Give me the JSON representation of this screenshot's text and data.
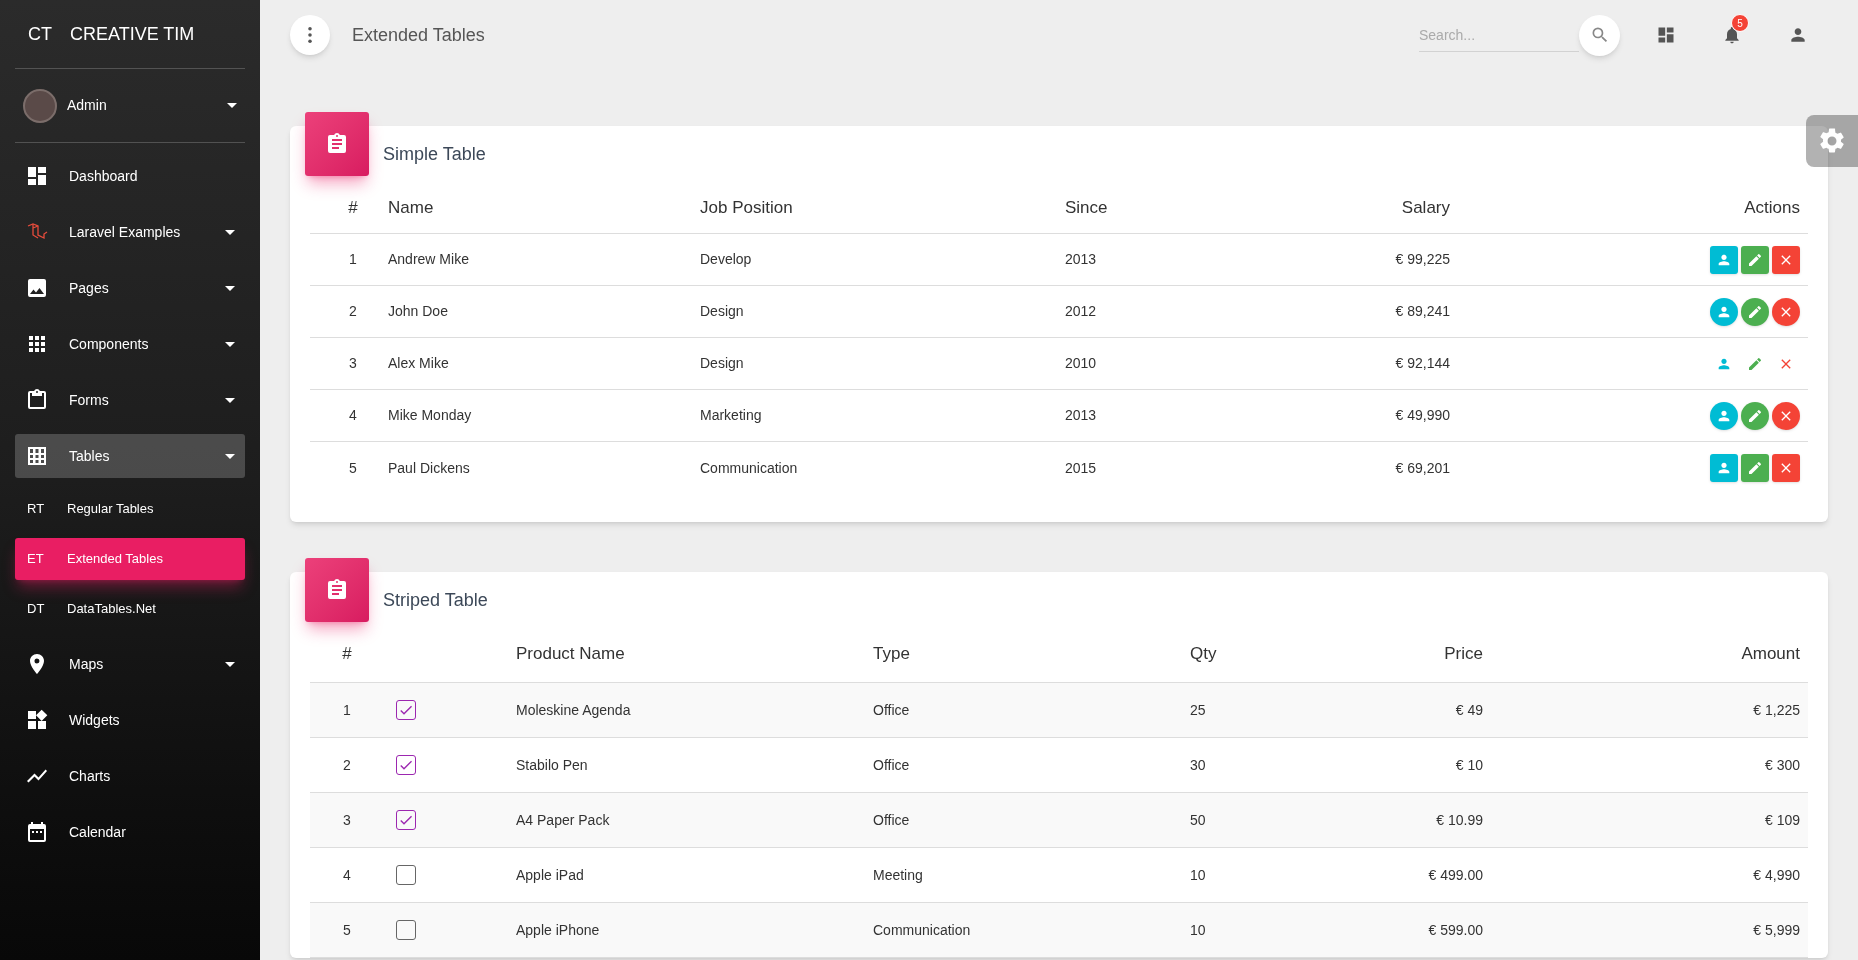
{
  "sidebar": {
    "logo": {
      "abbr": "CT",
      "text": "CREATIVE TIM"
    },
    "user": {
      "name": "Admin",
      "expandable": true
    },
    "items": [
      {
        "label": "Dashboard",
        "expandable": false,
        "selected": false
      },
      {
        "label": "Laravel Examples",
        "expandable": true,
        "selected": false
      },
      {
        "label": "Pages",
        "expandable": true,
        "selected": false
      },
      {
        "label": "Components",
        "expandable": true,
        "selected": false
      },
      {
        "label": "Forms",
        "expandable": true,
        "selected": false
      },
      {
        "label": "Tables",
        "expandable": true,
        "selected": true,
        "children": [
          {
            "abbr": "RT",
            "label": "Regular Tables",
            "selected": false
          },
          {
            "abbr": "ET",
            "label": "Extended Tables",
            "selected": true
          },
          {
            "abbr": "DT",
            "label": "DataTables.Net",
            "selected": false
          }
        ]
      },
      {
        "label": "Maps",
        "expandable": true,
        "selected": false
      },
      {
        "label": "Widgets",
        "expandable": false,
        "selected": false
      },
      {
        "label": "Charts",
        "expandable": false,
        "selected": false
      },
      {
        "label": "Calendar",
        "expandable": false,
        "selected": false
      }
    ]
  },
  "topbar": {
    "title": "Extended Tables",
    "search": {
      "placeholder": "Search..."
    },
    "notifications": "5"
  },
  "simple_table": {
    "title": "Simple Table",
    "columns": [
      "#",
      "Name",
      "Job Position",
      "Since",
      "Salary",
      "Actions"
    ],
    "rows": [
      {
        "cells": [
          "1",
          "Andrew Mike",
          "Develop",
          "2013",
          "€ 99,225"
        ],
        "kind": "square"
      },
      {
        "cells": [
          "2",
          "John Doe",
          "Design",
          "2012",
          "€ 89,241"
        ],
        "kind": "round"
      },
      {
        "cells": [
          "3",
          "Alex Mike",
          "Design",
          "2010",
          "€ 92,144"
        ],
        "kind": "plain"
      },
      {
        "cells": [
          "4",
          "Mike Monday",
          "Marketing",
          "2013",
          "€ 49,990"
        ],
        "kind": "round"
      },
      {
        "cells": [
          "5",
          "Paul Dickens",
          "Communication",
          "2015",
          "€ 69,201"
        ],
        "kind": "square"
      }
    ]
  },
  "striped_table": {
    "title": "Striped Table",
    "columns": [
      "#",
      "Product Name",
      "Type",
      "Qty",
      "Price",
      "Amount"
    ],
    "rows": [
      {
        "cells": [
          "1",
          "Moleskine Agenda",
          "Office",
          "25",
          "€ 49",
          "€ 1,225"
        ],
        "checked": true
      },
      {
        "cells": [
          "2",
          "Stabilo Pen",
          "Office",
          "30",
          "€ 10",
          "€ 300"
        ],
        "checked": true
      },
      {
        "cells": [
          "3",
          "A4 Paper Pack",
          "Office",
          "50",
          "€ 10.99",
          "€ 109"
        ],
        "checked": true
      },
      {
        "cells": [
          "4",
          "Apple iPad",
          "Meeting",
          "10",
          "€ 499.00",
          "€ 4,990"
        ],
        "checked": false
      },
      {
        "cells": [
          "5",
          "Apple iPhone",
          "Communication",
          "10",
          "€ 599.00",
          "€ 5,999"
        ],
        "checked": false
      }
    ]
  }
}
